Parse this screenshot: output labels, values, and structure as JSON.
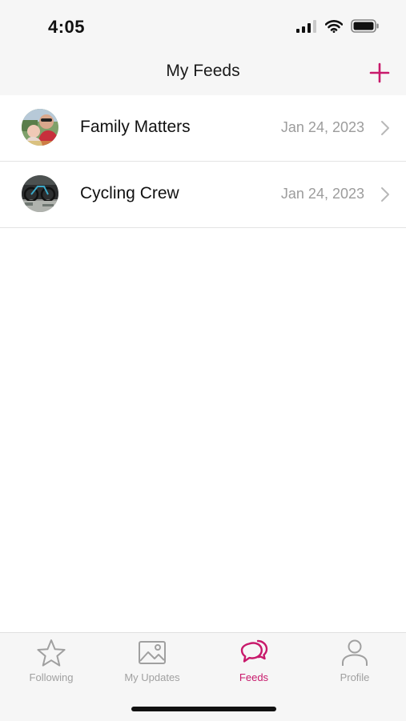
{
  "status_bar": {
    "time": "4:05"
  },
  "nav": {
    "title": "My Feeds",
    "add_icon": "plus-icon"
  },
  "feeds": [
    {
      "name": "Family Matters",
      "date": "Jan 24, 2023"
    },
    {
      "name": "Cycling Crew",
      "date": "Jan 24, 2023"
    }
  ],
  "tabs": [
    {
      "label": "Following",
      "icon": "star-icon",
      "active": false
    },
    {
      "label": "My Updates",
      "icon": "image-icon",
      "active": false
    },
    {
      "label": "Feeds",
      "icon": "chat-bubbles-icon",
      "active": true
    },
    {
      "label": "Profile",
      "icon": "person-icon",
      "active": false
    }
  ],
  "colors": {
    "accent": "#c8196b",
    "inactive": "#a0a0a0",
    "date_text": "#9c9c9c",
    "bar_background": "#f6f6f6"
  }
}
